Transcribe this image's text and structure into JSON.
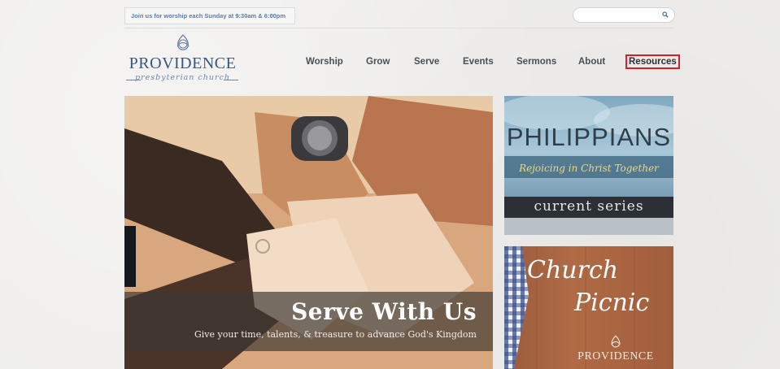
{
  "topbar": {
    "notice": "Join us for worship each Sunday at 9:30am & 6:00pm",
    "search_placeholder": ""
  },
  "logo": {
    "wordmark": "PROVIDENCE",
    "subtitle": "presbyterian church",
    "icon": "trinity-knot-icon"
  },
  "nav": {
    "items": [
      {
        "label": "Worship"
      },
      {
        "label": "Grow"
      },
      {
        "label": "Serve"
      },
      {
        "label": "Events"
      },
      {
        "label": "Sermons"
      },
      {
        "label": "About"
      },
      {
        "label": "Resources",
        "highlighted": true
      }
    ]
  },
  "hero": {
    "title": "Serve With Us",
    "subtitle": "Give your time, talents, & treasure to advance God's Kingdom"
  },
  "series_panel": {
    "title": "PHILIPPIANS",
    "tagline": "Rejoicing in Christ Together",
    "label": "current series"
  },
  "picnic_panel": {
    "title_line1": "Church",
    "title_line2": "Picnic",
    "brand": "PROVIDENCE"
  },
  "colors": {
    "brand_blue": "#365783",
    "highlight_red": "#d62028",
    "nav_text": "#4a4f55"
  }
}
